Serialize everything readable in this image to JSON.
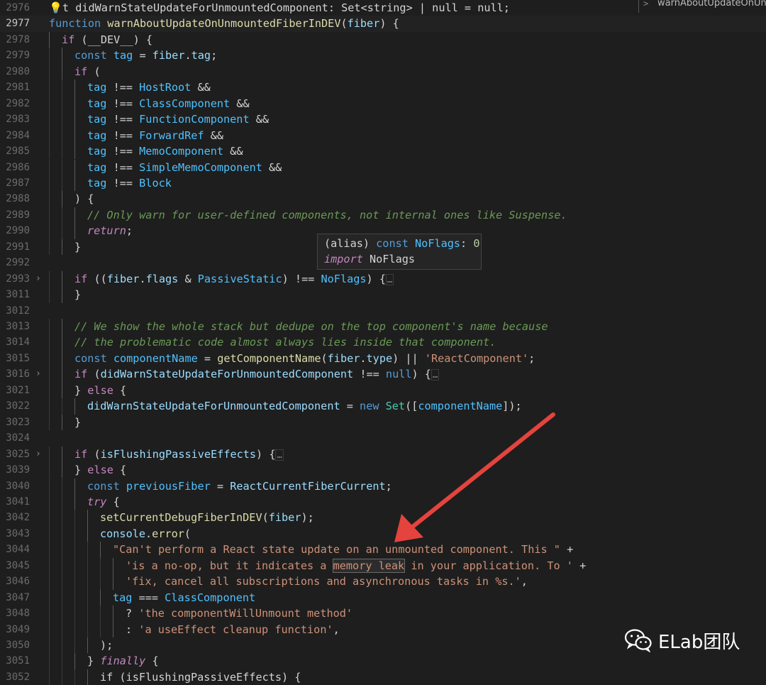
{
  "editor": {
    "colors": {
      "keyword": "#c586c0",
      "storage": "#569cd6",
      "function": "#dcdcaa",
      "variable": "#9cdcfe",
      "constant": "#4fc1ff",
      "string": "#ce9178",
      "comment": "#6a9955",
      "operator": "#d4d4d4",
      "type": "#4ec9b0",
      "number": "#b5cea8"
    },
    "lines": [
      {
        "n": "2976",
        "indent": 0,
        "tokens": [
          {
            "t": "💡",
            "c": "#e2c08d"
          },
          {
            "t": "t ",
            "c": "#d4d4d4"
          },
          {
            "t": "didWarnStateUpdateForUnmountedComponent",
            "c": "#d4d4d4"
          },
          {
            "t": ": ",
            "c": "#d4d4d4"
          },
          {
            "t": "Set",
            "c": "#d4d4d4"
          },
          {
            "t": "<",
            "c": "#d4d4d4"
          },
          {
            "t": "string",
            "c": "#d4d4d4"
          },
          {
            "t": "> | ",
            "c": "#d4d4d4"
          },
          {
            "t": "null",
            "c": "#d4d4d4"
          },
          {
            "t": " = ",
            "c": "#d4d4d4"
          },
          {
            "t": "null",
            "c": "#d4d4d4"
          },
          {
            "t": ";",
            "c": "#d4d4d4"
          }
        ]
      },
      {
        "n": "2977",
        "indent": 0,
        "current": true,
        "tokens": [
          {
            "t": "function ",
            "c": "#569cd6"
          },
          {
            "t": "warnAboutUpdateOnUnmountedFiberInDEV",
            "c": "#dcdcaa"
          },
          {
            "t": "(",
            "c": "#d4d4d4"
          },
          {
            "t": "fiber",
            "c": "#9cdcfe"
          },
          {
            "t": ") {",
            "c": "#d4d4d4"
          }
        ]
      },
      {
        "n": "2978",
        "indent": 1,
        "tokens": [
          {
            "t": "if ",
            "c": "#c586c0"
          },
          {
            "t": "(__DEV__) {",
            "c": "#d4d4d4"
          }
        ]
      },
      {
        "n": "2979",
        "indent": 2,
        "tokens": [
          {
            "t": "const ",
            "c": "#569cd6"
          },
          {
            "t": "tag",
            "c": "#4fc1ff"
          },
          {
            "t": " = ",
            "c": "#d4d4d4"
          },
          {
            "t": "fiber",
            "c": "#9cdcfe"
          },
          {
            "t": ".",
            "c": "#d4d4d4"
          },
          {
            "t": "tag",
            "c": "#9cdcfe"
          },
          {
            "t": ";",
            "c": "#d4d4d4"
          }
        ]
      },
      {
        "n": "2980",
        "indent": 2,
        "tokens": [
          {
            "t": "if ",
            "c": "#c586c0"
          },
          {
            "t": "(",
            "c": "#d4d4d4"
          }
        ]
      },
      {
        "n": "2981",
        "indent": 3,
        "tokens": [
          {
            "t": "tag",
            "c": "#4fc1ff"
          },
          {
            "t": " !== ",
            "c": "#d4d4d4"
          },
          {
            "t": "HostRoot",
            "c": "#4fc1ff"
          },
          {
            "t": " &&",
            "c": "#d4d4d4"
          }
        ]
      },
      {
        "n": "2982",
        "indent": 3,
        "tokens": [
          {
            "t": "tag",
            "c": "#4fc1ff"
          },
          {
            "t": " !== ",
            "c": "#d4d4d4"
          },
          {
            "t": "ClassComponent",
            "c": "#4fc1ff"
          },
          {
            "t": " &&",
            "c": "#d4d4d4"
          }
        ]
      },
      {
        "n": "2983",
        "indent": 3,
        "tokens": [
          {
            "t": "tag",
            "c": "#4fc1ff"
          },
          {
            "t": " !== ",
            "c": "#d4d4d4"
          },
          {
            "t": "FunctionComponent",
            "c": "#4fc1ff"
          },
          {
            "t": " &&",
            "c": "#d4d4d4"
          }
        ]
      },
      {
        "n": "2984",
        "indent": 3,
        "tokens": [
          {
            "t": "tag",
            "c": "#4fc1ff"
          },
          {
            "t": " !== ",
            "c": "#d4d4d4"
          },
          {
            "t": "ForwardRef",
            "c": "#4fc1ff"
          },
          {
            "t": " &&",
            "c": "#d4d4d4"
          }
        ]
      },
      {
        "n": "2985",
        "indent": 3,
        "tokens": [
          {
            "t": "tag",
            "c": "#4fc1ff"
          },
          {
            "t": " !== ",
            "c": "#d4d4d4"
          },
          {
            "t": "MemoComponent",
            "c": "#4fc1ff"
          },
          {
            "t": " &&",
            "c": "#d4d4d4"
          }
        ]
      },
      {
        "n": "2986",
        "indent": 3,
        "tokens": [
          {
            "t": "tag",
            "c": "#4fc1ff"
          },
          {
            "t": " !== ",
            "c": "#d4d4d4"
          },
          {
            "t": "SimpleMemoComponent",
            "c": "#4fc1ff"
          },
          {
            "t": " &&",
            "c": "#d4d4d4"
          }
        ]
      },
      {
        "n": "2987",
        "indent": 3,
        "tokens": [
          {
            "t": "tag",
            "c": "#4fc1ff"
          },
          {
            "t": " !== ",
            "c": "#d4d4d4"
          },
          {
            "t": "Block",
            "c": "#4fc1ff"
          }
        ]
      },
      {
        "n": "2988",
        "indent": 2,
        "tokens": [
          {
            "t": ") {",
            "c": "#d4d4d4"
          }
        ]
      },
      {
        "n": "2989",
        "indent": 3,
        "tokens": [
          {
            "t": "// Only warn for user-defined components, not internal ones like Suspense.",
            "c": "#6a9955",
            "i": true
          }
        ]
      },
      {
        "n": "2990",
        "indent": 3,
        "tokens": [
          {
            "t": "return",
            "c": "#c586c0",
            "i": true
          },
          {
            "t": ";",
            "c": "#d4d4d4"
          }
        ]
      },
      {
        "n": "2991",
        "indent": 2,
        "tokens": [
          {
            "t": "}",
            "c": "#d4d4d4"
          }
        ]
      },
      {
        "n": "2992",
        "indent": 0,
        "tokens": []
      },
      {
        "n": "2993",
        "indent": 2,
        "fold": true,
        "tokens": [
          {
            "t": "if ",
            "c": "#c586c0"
          },
          {
            "t": "((",
            "c": "#d4d4d4"
          },
          {
            "t": "fiber",
            "c": "#9cdcfe"
          },
          {
            "t": ".",
            "c": "#d4d4d4"
          },
          {
            "t": "flags",
            "c": "#9cdcfe"
          },
          {
            "t": " & ",
            "c": "#d4d4d4"
          },
          {
            "t": "PassiveStatic",
            "c": "#4fc1ff"
          },
          {
            "t": ") !== ",
            "c": "#d4d4d4"
          },
          {
            "t": "NoFlags",
            "c": "#4fc1ff"
          },
          {
            "t": ") {",
            "c": "#d4d4d4"
          },
          {
            "t": "…",
            "c": "#8f8f8f",
            "dots": true
          }
        ]
      },
      {
        "n": "3011",
        "indent": 2,
        "tokens": [
          {
            "t": "}",
            "c": "#d4d4d4"
          }
        ]
      },
      {
        "n": "3012",
        "indent": 0,
        "tokens": []
      },
      {
        "n": "3013",
        "indent": 2,
        "tokens": [
          {
            "t": "// We show the whole stack but dedupe on the top component's name because",
            "c": "#6a9955",
            "i": true
          }
        ]
      },
      {
        "n": "3014",
        "indent": 2,
        "tokens": [
          {
            "t": "// the problematic code almost always lies inside that component.",
            "c": "#6a9955",
            "i": true
          }
        ]
      },
      {
        "n": "3015",
        "indent": 2,
        "tokens": [
          {
            "t": "const ",
            "c": "#569cd6"
          },
          {
            "t": "componentName",
            "c": "#4fc1ff"
          },
          {
            "t": " = ",
            "c": "#d4d4d4"
          },
          {
            "t": "getComponentName",
            "c": "#dcdcaa"
          },
          {
            "t": "(",
            "c": "#d4d4d4"
          },
          {
            "t": "fiber",
            "c": "#9cdcfe"
          },
          {
            "t": ".",
            "c": "#d4d4d4"
          },
          {
            "t": "type",
            "c": "#9cdcfe"
          },
          {
            "t": ") || ",
            "c": "#d4d4d4"
          },
          {
            "t": "'ReactComponent'",
            "c": "#ce9178"
          },
          {
            "t": ";",
            "c": "#d4d4d4"
          }
        ]
      },
      {
        "n": "3016",
        "indent": 2,
        "fold": true,
        "tokens": [
          {
            "t": "if ",
            "c": "#c586c0"
          },
          {
            "t": "(",
            "c": "#d4d4d4"
          },
          {
            "t": "didWarnStateUpdateForUnmountedComponent",
            "c": "#9cdcfe"
          },
          {
            "t": " !== ",
            "c": "#d4d4d4"
          },
          {
            "t": "null",
            "c": "#569cd6"
          },
          {
            "t": ") {",
            "c": "#d4d4d4"
          },
          {
            "t": "…",
            "c": "#8f8f8f",
            "dots": true
          }
        ]
      },
      {
        "n": "3021",
        "indent": 2,
        "tokens": [
          {
            "t": "} ",
            "c": "#d4d4d4"
          },
          {
            "t": "else",
            "c": "#c586c0"
          },
          {
            "t": " {",
            "c": "#d4d4d4"
          }
        ]
      },
      {
        "n": "3022",
        "indent": 3,
        "tokens": [
          {
            "t": "didWarnStateUpdateForUnmountedComponent",
            "c": "#9cdcfe"
          },
          {
            "t": " = ",
            "c": "#d4d4d4"
          },
          {
            "t": "new ",
            "c": "#569cd6"
          },
          {
            "t": "Set",
            "c": "#4ec9b0"
          },
          {
            "t": "([",
            "c": "#d4d4d4"
          },
          {
            "t": "componentName",
            "c": "#4fc1ff"
          },
          {
            "t": "]);",
            "c": "#d4d4d4"
          }
        ]
      },
      {
        "n": "3023",
        "indent": 2,
        "tokens": [
          {
            "t": "}",
            "c": "#d4d4d4"
          }
        ]
      },
      {
        "n": "3024",
        "indent": 0,
        "tokens": []
      },
      {
        "n": "3025",
        "indent": 2,
        "fold": true,
        "tokens": [
          {
            "t": "if ",
            "c": "#c586c0"
          },
          {
            "t": "(",
            "c": "#d4d4d4"
          },
          {
            "t": "isFlushingPassiveEffects",
            "c": "#9cdcfe"
          },
          {
            "t": ") {",
            "c": "#d4d4d4"
          },
          {
            "t": "…",
            "c": "#8f8f8f",
            "dots": true
          }
        ]
      },
      {
        "n": "3039",
        "indent": 2,
        "tokens": [
          {
            "t": "} ",
            "c": "#d4d4d4"
          },
          {
            "t": "else",
            "c": "#c586c0"
          },
          {
            "t": " {",
            "c": "#d4d4d4"
          }
        ]
      },
      {
        "n": "3040",
        "indent": 3,
        "tokens": [
          {
            "t": "const ",
            "c": "#569cd6"
          },
          {
            "t": "previousFiber",
            "c": "#4fc1ff"
          },
          {
            "t": " = ",
            "c": "#d4d4d4"
          },
          {
            "t": "ReactCurrentFiberCurrent",
            "c": "#9cdcfe"
          },
          {
            "t": ";",
            "c": "#d4d4d4"
          }
        ]
      },
      {
        "n": "3041",
        "indent": 3,
        "tokens": [
          {
            "t": "try",
            "c": "#c586c0",
            "i": true
          },
          {
            "t": " {",
            "c": "#d4d4d4"
          }
        ]
      },
      {
        "n": "3042",
        "indent": 4,
        "tokens": [
          {
            "t": "setCurrentDebugFiberInDEV",
            "c": "#dcdcaa"
          },
          {
            "t": "(",
            "c": "#d4d4d4"
          },
          {
            "t": "fiber",
            "c": "#9cdcfe"
          },
          {
            "t": ");",
            "c": "#d4d4d4"
          }
        ]
      },
      {
        "n": "3043",
        "indent": 4,
        "tokens": [
          {
            "t": "console",
            "c": "#9cdcfe"
          },
          {
            "t": ".",
            "c": "#d4d4d4"
          },
          {
            "t": "error",
            "c": "#dcdcaa"
          },
          {
            "t": "(",
            "c": "#d4d4d4"
          }
        ]
      },
      {
        "n": "3044",
        "indent": 5,
        "tokens": [
          {
            "t": "\"Can't perform a React state update on an unmounted component. This \"",
            "c": "#ce9178"
          },
          {
            "t": " +",
            "c": "#d4d4d4"
          }
        ]
      },
      {
        "n": "3045",
        "indent": 6,
        "tokens": [
          {
            "t": "'is a no-op, but it indicates a ",
            "c": "#ce9178"
          },
          {
            "t": "memory leak",
            "c": "#ce9178",
            "box": true
          },
          {
            "t": " in your application. To '",
            "c": "#ce9178"
          },
          {
            "t": " +",
            "c": "#d4d4d4"
          }
        ]
      },
      {
        "n": "3046",
        "indent": 6,
        "tokens": [
          {
            "t": "'fix, cancel all subscriptions and asynchronous tasks in %s.'",
            "c": "#ce9178"
          },
          {
            "t": ",",
            "c": "#d4d4d4"
          }
        ]
      },
      {
        "n": "3047",
        "indent": 5,
        "tokens": [
          {
            "t": "tag",
            "c": "#4fc1ff"
          },
          {
            "t": " === ",
            "c": "#d4d4d4"
          },
          {
            "t": "ClassComponent",
            "c": "#4fc1ff"
          }
        ]
      },
      {
        "n": "3048",
        "indent": 6,
        "tokens": [
          {
            "t": "? ",
            "c": "#d4d4d4"
          },
          {
            "t": "'the componentWillUnmount method'",
            "c": "#ce9178"
          }
        ]
      },
      {
        "n": "3049",
        "indent": 6,
        "tokens": [
          {
            "t": ": ",
            "c": "#d4d4d4"
          },
          {
            "t": "'a useEffect cleanup function'",
            "c": "#ce9178"
          },
          {
            "t": ",",
            "c": "#d4d4d4"
          }
        ]
      },
      {
        "n": "3050",
        "indent": 4,
        "tokens": [
          {
            "t": ");",
            "c": "#d4d4d4"
          }
        ]
      },
      {
        "n": "3051",
        "indent": 3,
        "tokens": [
          {
            "t": "} ",
            "c": "#d4d4d4"
          },
          {
            "t": "finally",
            "c": "#c586c0",
            "i": true
          },
          {
            "t": " {",
            "c": "#d4d4d4"
          }
        ]
      },
      {
        "n": "3052",
        "indent": 4,
        "tokens": [
          {
            "t": "if (isFlushingPassiveEffects) {",
            "c": "#d4d4d4"
          }
        ]
      }
    ]
  },
  "overview_ruler": {
    "chevron": ">",
    "label": "warnAboutUpdateOnUn"
  },
  "hover": {
    "line1": [
      {
        "t": "(alias) ",
        "c": "#d4d4d4"
      },
      {
        "t": "const ",
        "c": "#569cd6"
      },
      {
        "t": "NoFlags",
        "c": "#4fc1ff"
      },
      {
        "t": ": ",
        "c": "#d4d4d4"
      },
      {
        "t": "0",
        "c": "#b5cea8"
      }
    ],
    "line2": [
      {
        "t": "import",
        "c": "#c586c0",
        "i": true
      },
      {
        "t": " NoFlags",
        "c": "#d4d4d4"
      }
    ]
  },
  "annotation": {
    "arrow_color": "#e5433e"
  },
  "watermark": {
    "icon": "wechat-icon",
    "text": "ELab团队"
  }
}
